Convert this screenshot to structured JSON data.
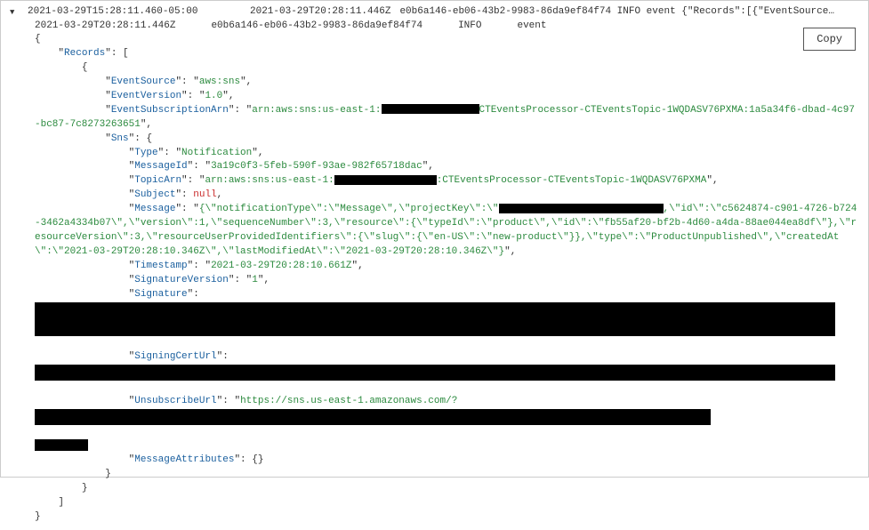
{
  "header": {
    "expand_glyph": "▼",
    "ts_local": "2021-03-29T15:28:11.460-05:00",
    "ts_utc": "2021-03-29T20:28:11.446Z",
    "summary": "e0b6a146-eb06-43b2-9983-86da9ef84f74 INFO event {\"Records\":[{\"EventSource…"
  },
  "copy_label": "Copy",
  "detail_header": {
    "ts": "2021-03-29T20:28:11.446Z",
    "req": "e0b6a146-eb06-43b2-9983-86da9ef84f74",
    "level": "INFO",
    "event": "event"
  },
  "json": {
    "records": "Records",
    "eventSource_k": "EventSource",
    "eventSource_v": "aws:sns",
    "eventVersion_k": "EventVersion",
    "eventVersion_v": "1.0",
    "eventSubArn_k": "EventSubscriptionArn",
    "eventSubArn_v1": "arn:aws:sns:us-east-1:",
    "eventSubArn_v2": "CTEventsProcessor-CTEventsTopic-1WQDASV76PXMA:1a5a34f6-dbad-4c97-bc87-7c8273263651",
    "sns": "Sns",
    "type_k": "Type",
    "type_v": "Notification",
    "messageId_k": "MessageId",
    "messageId_v": "3a19c0f3-5feb-590f-93ae-982f65718dac",
    "topicArn_k": "TopicArn",
    "topicArn_v1": "arn:aws:sns:us-east-1:",
    "topicArn_v2": ":CTEventsProcessor-CTEventsTopic-1WQDASV76PXMA",
    "subject_k": "Subject",
    "subject_v": "null",
    "message_k": "Message",
    "message_v1": "{\\\"notificationType\\\":\\\"Message\\\",\\\"projectKey\\\":\\\"",
    "message_v2": ",\\\"id\\\":\\\"c5624874-c901-4726-b724-3462a4334b07\\\",\\\"version\\\":1,\\\"sequenceNumber\\\":3,\\\"resource\\\":{\\\"typeId\\\":\\\"product\\\",\\\"id\\\":\\\"fb55af20-bf2b-4d60-a4da-88ae044ea8df\\\"},\\\"resourceVersion\\\":3,\\\"resourceUserProvidedIdentifiers\\\":{\\\"slug\\\":{\\\"en-US\\\":\\\"new-product\\\"}},\\\"type\\\":\\\"ProductUnpublished\\\",\\\"createdAt\\\":\\\"2021-03-29T20:28:10.346Z\\\",\\\"lastModifiedAt\\\":\\\"2021-03-29T20:28:10.346Z\\\"}",
    "timestamp_k": "Timestamp",
    "timestamp_v": "2021-03-29T20:28:10.661Z",
    "sigVer_k": "SignatureVersion",
    "sigVer_v": "1",
    "signature_k": "Signature",
    "signingCert_k": "SigningCertUrl",
    "unsub_k": "UnsubscribeUrl",
    "unsub_v": "https://sns.us-east-1.amazonaws.com/?",
    "msgAttr_k": "MessageAttributes"
  }
}
